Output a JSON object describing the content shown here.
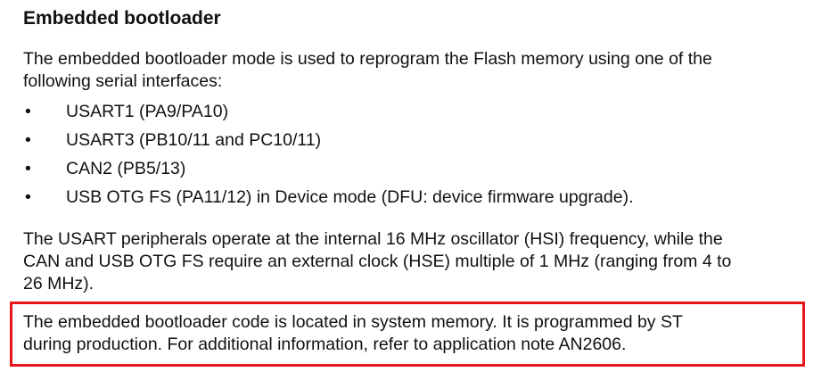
{
  "heading": "Embedded bootloader",
  "intro": {
    "line1": "The embedded bootloader mode is used to reprogram the Flash memory using one of the",
    "line2": "following serial interfaces:"
  },
  "bullet_symbol": "•",
  "interfaces": [
    "USART1 (PA9/PA10)",
    "USART3 (PB10/11 and PC10/11)",
    "CAN2 (PB5/13)",
    "USB OTG FS (PA11/12) in Device mode (DFU: device firmware upgrade)."
  ],
  "usart_paragraph": {
    "line1": "The USART peripherals operate at the internal 16 MHz oscillator (HSI) frequency, while the",
    "line2": "CAN and USB OTG FS require an external clock (HSE) multiple of 1 MHz (ranging from 4 to",
    "line3": "26 MHz)."
  },
  "highlighted_note": {
    "line1": "The embedded bootloader code is located in system memory. It is programmed by ST",
    "line2": "during production. For additional information, refer to application note AN2606."
  },
  "highlight_color": "#e8151b"
}
